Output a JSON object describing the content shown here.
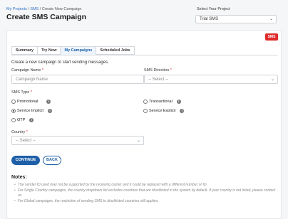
{
  "header": {
    "breadcrumb": {
      "root": "My Projects",
      "sep1": " / ",
      "mid": "SMS",
      "sep2": " / ",
      "current": "Create New Campaign"
    },
    "title": "Create SMS Campaign",
    "project_label": "Select Your Project",
    "project_value": "Trial SMS"
  },
  "badge": {
    "label": "SMS",
    "color": "#e02a2a"
  },
  "tabs": [
    {
      "label": "Summary",
      "active": false
    },
    {
      "label": "Try Now",
      "active": false
    },
    {
      "label": "My Campaigns",
      "active": true
    },
    {
      "label": "Scheduled Jobs",
      "active": false
    }
  ],
  "form": {
    "intro": "Create a new campaign to start sending messages.",
    "campaign_name_label": "Campaign Name",
    "campaign_name_placeholder": "Campaign Name",
    "direction_label": "SMS Direction",
    "direction_value": "-- Select --",
    "sms_type_label": "SMS Type",
    "sms_types": [
      {
        "label": "Promotional",
        "checked": false
      },
      {
        "label": "Transactional",
        "checked": false
      },
      {
        "label": "Service Implicit",
        "checked": true
      },
      {
        "label": "Service Explicit",
        "checked": false
      },
      {
        "label": "OTP",
        "checked": false
      }
    ],
    "country_label": "Country",
    "country_value": "-- Select --",
    "required_mark": "*",
    "info_glyph": "i"
  },
  "actions": {
    "continue": "CONTINUE",
    "back": "BACK"
  },
  "notes": {
    "title": "Notes:",
    "items": [
      "The sender ID used may not be supported by the receiving carrier and it could be replaced with a different number or ID.",
      "For Single Country campaigns, the country dropdown list excludes countries that are blocklisted in the system by default. If your country is not listed, please contact us.",
      "For Global campaigns, the restriction of sending SMS to blocklisted countries still applies."
    ]
  },
  "theme": {
    "primary": "#1e5fa8",
    "link": "#2b6fc4",
    "danger": "#e02a2a"
  }
}
